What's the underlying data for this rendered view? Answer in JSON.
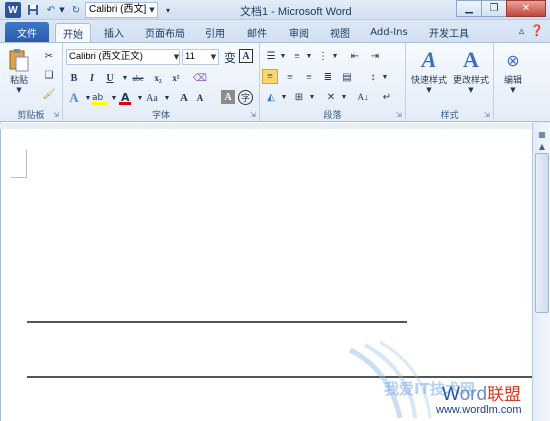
{
  "app": {
    "window_title": "文档1 - Microsoft Word",
    "app_icon_label": "W"
  },
  "quick_access": {
    "font_name": "Calibri (西文]"
  },
  "tabs": [
    {
      "label": "文件"
    },
    {
      "label": "开始"
    },
    {
      "label": "插入"
    },
    {
      "label": "页面布局"
    },
    {
      "label": "引用"
    },
    {
      "label": "邮件"
    },
    {
      "label": "审阅"
    },
    {
      "label": "视图"
    },
    {
      "label": "Add-Ins"
    },
    {
      "label": "开发工具"
    }
  ],
  "ribbon": {
    "clipboard": {
      "group_label": "剪贴板",
      "paste_label": "粘贴"
    },
    "font": {
      "group_label": "字体",
      "font_name": "Calibri (西文正文)",
      "font_size": "11",
      "bold": "B",
      "italic": "I",
      "underline": "U",
      "strike": "abc",
      "subscript": "x₂",
      "superscript": "x²",
      "grow": "A",
      "shrink": "A",
      "change_case": "Aa",
      "wen": "变",
      "border_a": "A",
      "char_shade": "A",
      "enclose": "字"
    },
    "paragraph": {
      "group_label": "段落"
    },
    "styles": {
      "group_label": "样式",
      "quick_styles": "快速样式",
      "change_styles": "更改样式"
    },
    "editing": {
      "label": "编辑"
    }
  },
  "watermark": {
    "text_cn": "我爱IT技术网",
    "brand_w": "W",
    "brand_rest": "ord",
    "brand_cn": "联盟",
    "url": "www.wordlm.com"
  },
  "colors": {
    "accent": "#2b579a",
    "file_tab": "#2a5caa",
    "highlight": "#ffff00",
    "font_color": "#e00000"
  }
}
